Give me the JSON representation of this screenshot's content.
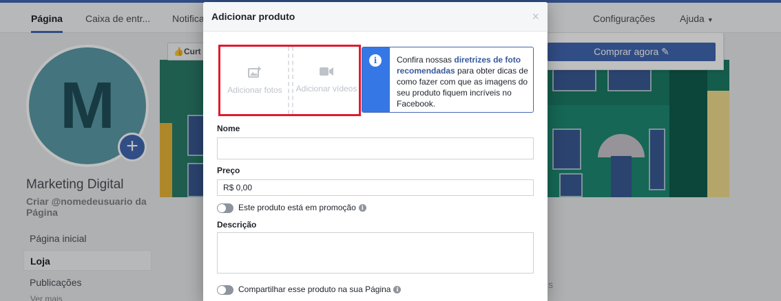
{
  "tabs": [
    {
      "label": "Página",
      "active": true
    },
    {
      "label": "Caixa de entr..."
    },
    {
      "label": "Notifica"
    },
    {
      "label": "Configurações"
    },
    {
      "label": "Ajuda"
    }
  ],
  "sidebar": {
    "avatar_letter": "M",
    "page_name": "Marketing Digital",
    "username_prompt": "Criar @nomedeusuario da Página",
    "items": [
      {
        "label": "Página inicial"
      },
      {
        "label": "Loja",
        "active": true
      },
      {
        "label": "Publicações"
      }
    ],
    "see_more": "Ver mais"
  },
  "page_actions": {
    "like_label": "Curt",
    "shop_label": "Comprar agora",
    "shop_icon": "pencil-icon",
    "stray_text": "s"
  },
  "modal": {
    "title": "Adicionar produto",
    "close": "×",
    "add_photos": "Adicionar fotos",
    "add_photos_icon": "image-plus-icon",
    "add_videos": "Adicionar vídeos",
    "add_videos_icon": "video-camera-icon",
    "info": {
      "icon": "i",
      "text_before": "Confira nossas ",
      "link": "diretrizes de foto recomendadas",
      "text_after": " para obter dicas de como fazer com que as imagens do seu produto fiquem incríveis no Facebook."
    },
    "name_label": "Nome",
    "name_value": "",
    "price_label": "Preço",
    "price_value": "R$ 0,00",
    "promo_label": "Este produto está em promoção",
    "description_label": "Descrição",
    "description_value": "",
    "share_label": "Compartilhar esse produto na sua Página"
  },
  "colors": {
    "brand": "#4267b2",
    "highlight": "#e0192e",
    "info_accent": "#3578e5"
  }
}
